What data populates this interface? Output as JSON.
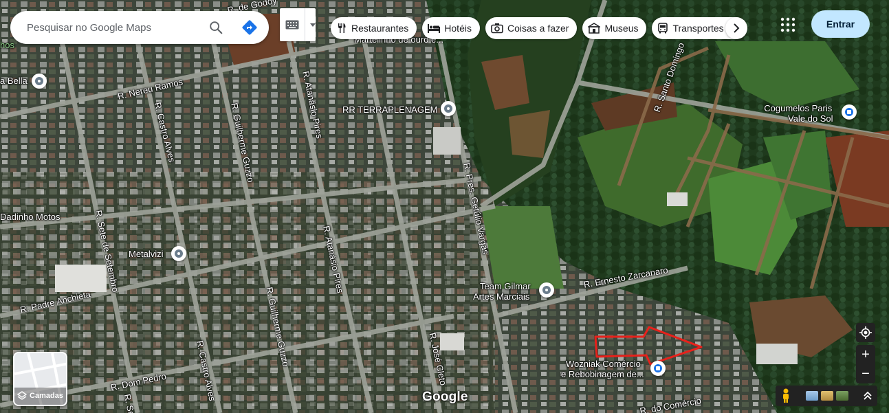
{
  "search": {
    "placeholder": "Pesquisar no Google Maps",
    "search_icon": "search-icon",
    "directions_icon": "directions-icon"
  },
  "keyboard": {
    "icon": "keyboard-icon",
    "dropdown_icon": "caret-down-icon"
  },
  "chips": [
    {
      "label": "Restaurantes",
      "icon": "fork-knife-icon"
    },
    {
      "label": "Hotéis",
      "icon": "bed-icon"
    },
    {
      "label": "Coisas a fazer",
      "icon": "camera-icon"
    },
    {
      "label": "Museus",
      "icon": "museum-icon"
    },
    {
      "label": "Transportes",
      "icon": "bus-icon"
    }
  ],
  "header": {
    "signin_label": "Entrar",
    "apps_icon": "apps-grid-icon"
  },
  "streets": {
    "nereu_ramos": "R. Nereu Ramos",
    "castro_alves_top": "R. Castro Alves",
    "guilherme_guzzo_top": "R. Guilherme Guzzo",
    "atanasio_pires_top": "R. Atanásio Pires",
    "pres_getulio": "R. Pres. Getúlio Vargas",
    "santo_domingo": "R. Santo Domingo",
    "sete_setembro": "R. Sete de Setembro",
    "atanasio_pires_mid": "R. Atanásio Pires",
    "padre_anchieta": "R. Padre Anchieta",
    "guilherme_guzzo_bot": "R. Guilherme Guzzo",
    "castro_alves_bot": "R. Castro Alves",
    "jose_cleto": "R. José Cleto",
    "ernesto_zarcanaro": "R. Ernesto Zarcanaro",
    "dom_pedro": "R. Dom Pedro",
    "do_comercio": "R. do Comércio",
    "top_cut_godoy": "R. de Godoy",
    "top_cut_martelinho": "Martelinho de ouro e...",
    "edge_hos": "hos",
    "edge_se": "R. Se"
  },
  "places": {
    "bella": "a Bella",
    "rr_terraplenagem": "RR TERRAPLENAGEM",
    "cogumelos_line1": "Cogumelos Paris",
    "cogumelos_line2": "Vale do Sol",
    "dadinho": "Dadinho Motos",
    "metalvizi": "Metalvizi",
    "team_gilmar_line1": "Team Gilmar",
    "team_gilmar_line2": "Artes Marciais",
    "wozniak_line1": "Wozniak Comércio",
    "wozniak_line2": "e Rebobinagem de..."
  },
  "controls": {
    "layers_label": "Camadas",
    "layers_icon": "layers-icon",
    "my_location_icon": "my-location-icon",
    "zoom_in": "+",
    "zoom_out": "−",
    "pegman_icon": "pegman-icon",
    "expand_icon": "chevron-double-up-icon",
    "google_logo": "Google"
  },
  "colors": {
    "signin_bg": "#c2e7ff",
    "arrow_red": "#e8211b",
    "blue_pin": "#1a73e8",
    "directions": "#1a73e8"
  }
}
